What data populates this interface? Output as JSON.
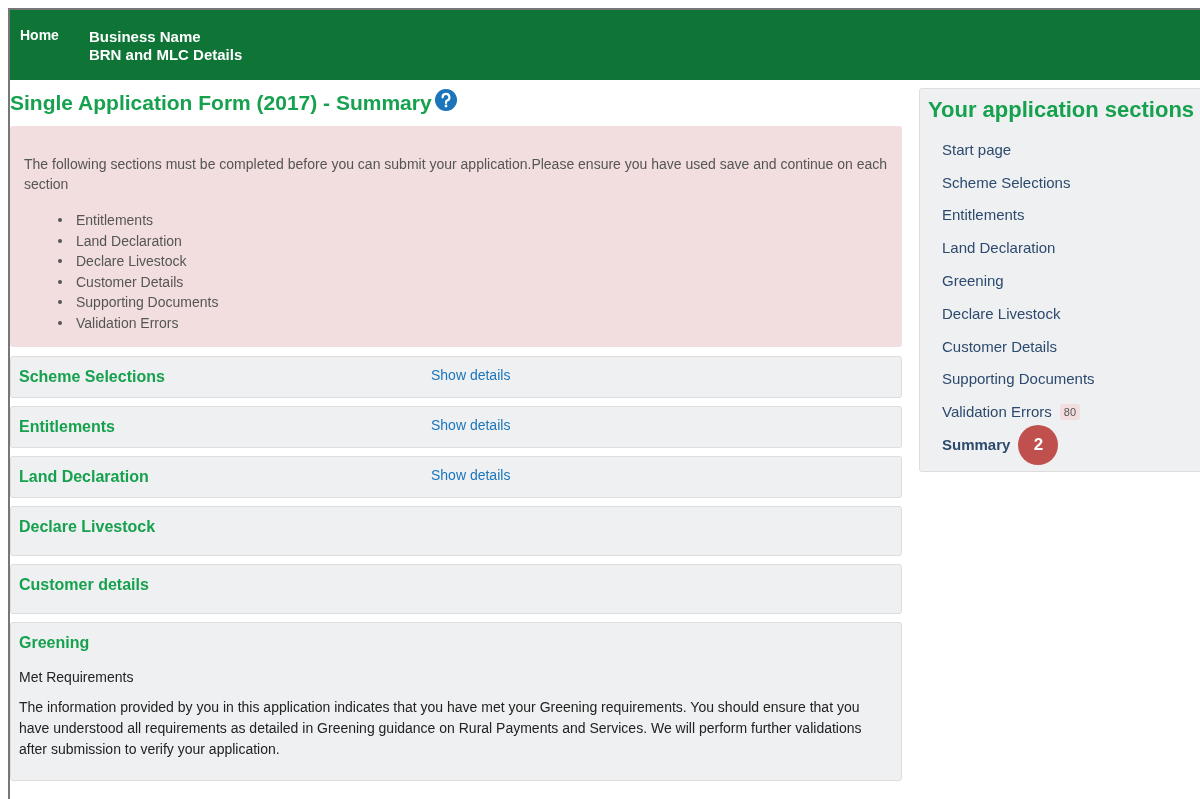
{
  "header": {
    "home": "Home",
    "business_name": "Business Name",
    "details": "BRN and MLC Details"
  },
  "title": "Single Application Form (2017) - Summary",
  "alert": {
    "message": "The following sections must be completed before you can submit your application.Please ensure you have used save and continue on each section",
    "items": [
      "Entitlements",
      "Land Declaration",
      "Declare Livestock",
      "Customer Details",
      "Supporting Documents",
      "Validation Errors"
    ]
  },
  "sections": [
    {
      "kind": "collapsed",
      "title": "Scheme Selections",
      "link": "Show details"
    },
    {
      "kind": "collapsed",
      "title": "Entitlements",
      "link": "Show details"
    },
    {
      "kind": "collapsed",
      "title": "Land Declaration",
      "link": "Show details"
    },
    {
      "kind": "empty",
      "title": "Declare Livestock"
    },
    {
      "kind": "empty",
      "title": "Customer details"
    },
    {
      "kind": "detail",
      "title": "Greening",
      "subtitle": "Met Requirements",
      "text": "The information provided by you in this application indicates that you have met your Greening requirements. You should ensure that you have understood all requirements as detailed in Greening guidance on Rural Payments and Services. We will perform further validations after submission to verify your application."
    }
  ],
  "sidebar": {
    "title": "Your application sections",
    "items": [
      {
        "label": "Start page",
        "selected": false
      },
      {
        "label": "Scheme Selections",
        "selected": false
      },
      {
        "label": "Entitlements",
        "selected": false
      },
      {
        "label": "Land Declaration",
        "selected": false
      },
      {
        "label": "Greening",
        "selected": false
      },
      {
        "label": "Declare Livestock",
        "selected": false
      },
      {
        "label": "Customer Details",
        "selected": false
      },
      {
        "label": "Supporting Documents",
        "selected": false
      },
      {
        "label": "Validation Errors",
        "selected": false,
        "badge": "80"
      },
      {
        "label": "Summary",
        "selected": true,
        "callout": "2"
      }
    ]
  }
}
